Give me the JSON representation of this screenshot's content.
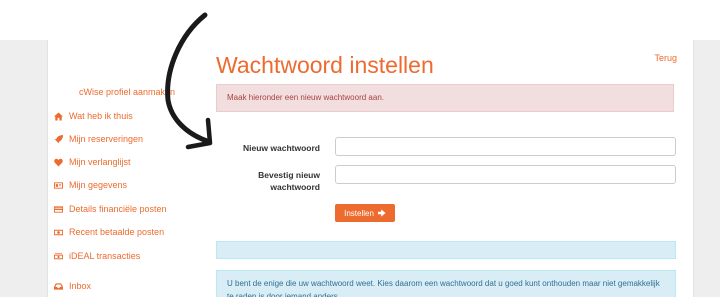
{
  "sidebar": {
    "top_link": "cWise profiel aanmaken",
    "items": [
      {
        "label": "Wat heb ik thuis",
        "icon": "home-icon"
      },
      {
        "label": "Mijn reserveringen",
        "icon": "rocket-icon"
      },
      {
        "label": "Mijn verlanglijst",
        "icon": "heart-icon"
      },
      {
        "label": "Mijn gegevens",
        "icon": "id-card-icon"
      },
      {
        "label": "Details financiële posten",
        "icon": "card-icon"
      },
      {
        "label": "Recent betaalde posten",
        "icon": "money-icon"
      },
      {
        "label": "iDEAL transacties",
        "icon": "money-stack-icon"
      },
      {
        "label": "Inbox",
        "icon": "inbox-icon"
      }
    ]
  },
  "main": {
    "title": "Wachtwoord instellen",
    "back_link": "Terug",
    "alert": "Maak hieronder een nieuw wachtwoord aan.",
    "fields": {
      "new_password_label": "Nieuw wachtwoord",
      "confirm_password_label": "Bevestig nieuw wachtwoord"
    },
    "submit_label": "Instellen",
    "info": "U bent de enige die uw wachtwoord weet. Kies daarom een wachtwoord dat u goed kunt onthouden maar niet gemakkelijk te raden is door iemand anders."
  },
  "colors": {
    "accent": "#ed6b2f",
    "alert_bg": "#f2dede",
    "info_bg": "#d9edf7",
    "annotation_arrow": "#1a1a1a"
  }
}
